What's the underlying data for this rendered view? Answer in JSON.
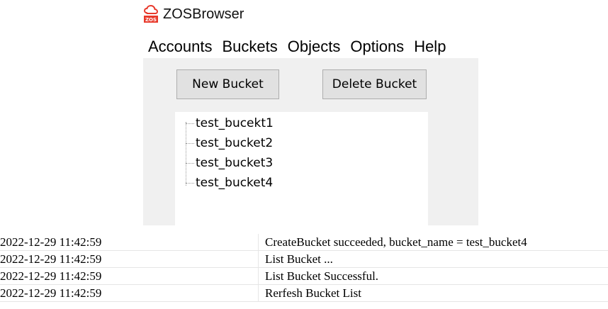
{
  "app": {
    "title": "ZOSBrowser",
    "logo_icon": "cloud-logo-icon",
    "logo_text": "ZOS",
    "brand_color": "#e8392b"
  },
  "menu": {
    "items": [
      {
        "label": "Accounts"
      },
      {
        "label": "Buckets"
      },
      {
        "label": "Objects"
      },
      {
        "label": "Options"
      },
      {
        "label": "Help"
      }
    ]
  },
  "toolbar": {
    "new_bucket_label": "New Bucket",
    "delete_bucket_label": "Delete Bucket"
  },
  "buckets": {
    "items": [
      {
        "name": "test_bucekt1"
      },
      {
        "name": "test_bucket2"
      },
      {
        "name": "test_bucket3"
      },
      {
        "name": "test_bucket4"
      }
    ]
  },
  "log": {
    "rows": [
      {
        "time": "2022-12-29 11:42:59",
        "message": "CreateBucket succeeded, bucket_name = test_bucket4"
      },
      {
        "time": "2022-12-29 11:42:59",
        "message": "List Bucket ..."
      },
      {
        "time": "2022-12-29 11:42:59",
        "message": "List Bucket Successful."
      },
      {
        "time": "2022-12-29 11:42:59",
        "message": "Rerfesh Bucket List"
      }
    ]
  }
}
